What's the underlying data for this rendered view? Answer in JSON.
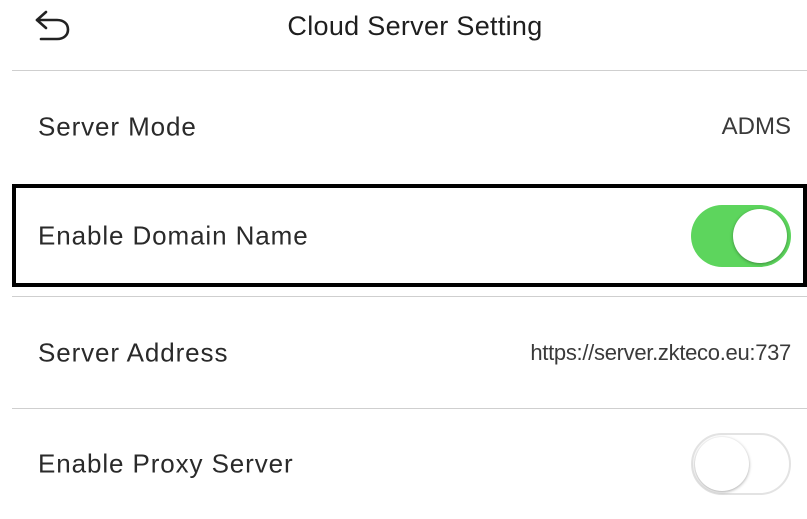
{
  "header": {
    "title": "Cloud Server Setting",
    "back_icon": "back-arrow-icon"
  },
  "rows": {
    "server_mode": {
      "label": "Server Mode",
      "value": "ADMS"
    },
    "enable_domain_name": {
      "label": "Enable Domain Name",
      "toggle_state": "on"
    },
    "server_address": {
      "label": "Server Address",
      "value": "https://server.zkteco.eu:737"
    },
    "enable_proxy_server": {
      "label": "Enable Proxy Server",
      "toggle_state": "off"
    }
  },
  "colors": {
    "toggle_on": "#5dd55d",
    "highlight_border": "#000000",
    "divider": "#cfcfcf"
  }
}
